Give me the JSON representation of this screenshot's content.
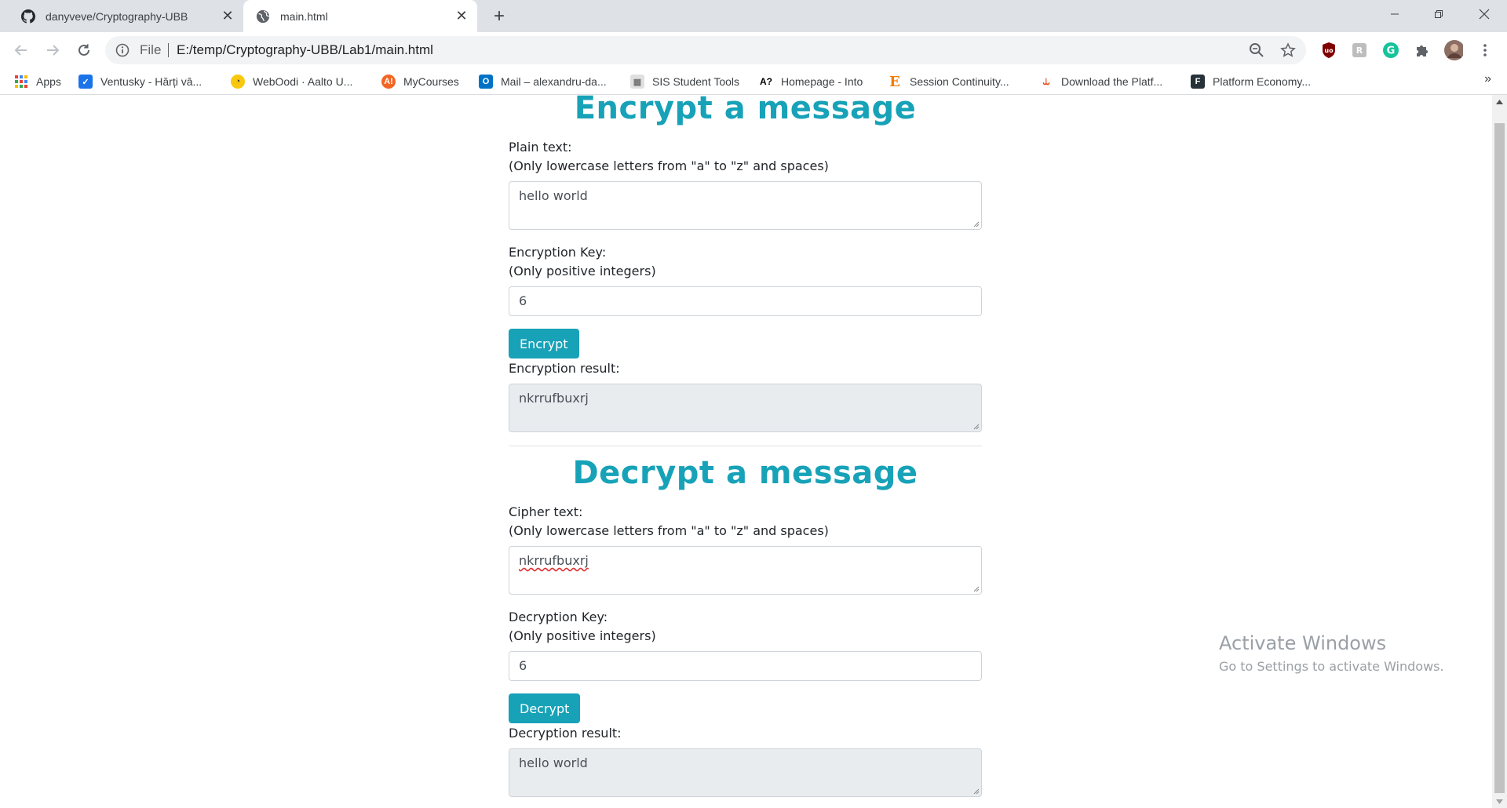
{
  "browser": {
    "tabs": [
      {
        "title": "danyveve/Cryptography-UBB",
        "icon": "github-icon",
        "active": false
      },
      {
        "title": "main.html",
        "icon": "globe-icon",
        "active": true
      }
    ],
    "address": {
      "scheme": "File",
      "url": "E:/temp/Cryptography-UBB/Lab1/main.html"
    },
    "bookmarks": [
      {
        "label": "Apps",
        "icon": "apps-grid-icon",
        "color": "#4285f4"
      },
      {
        "label": "Ventusky - Hărți vâ...",
        "icon": "ventusky-icon",
        "color": "#1a73e8"
      },
      {
        "label": "WebOodi · Aalto U...",
        "icon": "weboodi-icon",
        "color": "#f9c80e"
      },
      {
        "label": "MyCourses",
        "icon": "mycourses-icon",
        "color": "#f26522"
      },
      {
        "label": "Mail – alexandru-da...",
        "icon": "outlook-icon",
        "color": "#0072c6"
      },
      {
        "label": "SIS Student Tools",
        "icon": "sis-icon",
        "color": "#9e9e9e"
      },
      {
        "label": "Homepage - Into",
        "icon": "into-icon",
        "color": "#000000"
      },
      {
        "label": "Session Continuity...",
        "icon": "session-icon",
        "color": "#f57c00"
      },
      {
        "label": "Download the Platf...",
        "icon": "download-platform-icon",
        "color": "#e64a19"
      },
      {
        "label": "Platform Economy...",
        "icon": "platform-economy-icon",
        "color": "#263238"
      }
    ]
  },
  "page": {
    "encrypt": {
      "title": "Encrypt a message",
      "plain_label": "Plain text:",
      "plain_hint": "(Only lowercase letters from \"a\" to \"z\" and spaces)",
      "plain_value": "hello world",
      "key_label": "Encryption Key:",
      "key_hint": "(Only positive integers)",
      "key_value": "6",
      "button": "Encrypt",
      "result_label": "Encryption result:",
      "result_value": "nkrrufbuxrj"
    },
    "decrypt": {
      "title": "Decrypt a message",
      "cipher_label": "Cipher text:",
      "cipher_hint": "(Only lowercase letters from \"a\" to \"z\" and spaces)",
      "cipher_value": "nkrrufbuxrj",
      "key_label": "Decryption Key:",
      "key_hint": "(Only positive integers)",
      "key_value": "6",
      "button": "Decrypt",
      "result_label": "Decryption result:",
      "result_value": "hello world"
    },
    "accent_color": "#17a2b8"
  },
  "watermark": {
    "title": "Activate Windows",
    "subtitle": "Go to Settings to activate Windows."
  }
}
